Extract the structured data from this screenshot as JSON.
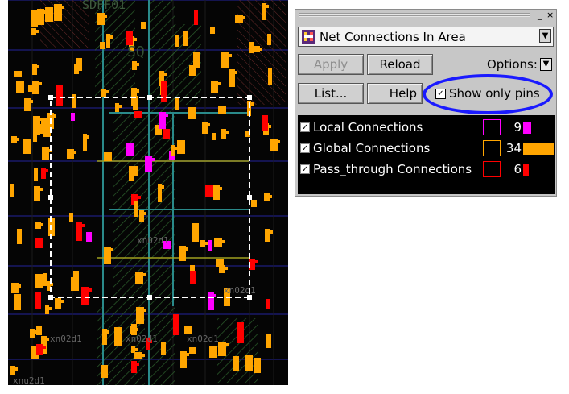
{
  "window": {
    "title": "Net Connections In Area",
    "minimize_glyph": "_",
    "close_glyph": "×"
  },
  "toolbar": {
    "apply_label": "Apply",
    "reload_label": "Reload",
    "options_label": "Options:",
    "list_label": "List...",
    "help_label": "Help",
    "show_only_pins_label": "Show only pins",
    "show_only_pins_checked": true
  },
  "connections": [
    {
      "label": "Local Connections",
      "count": "9",
      "color": "#ff00ff",
      "fill_fraction": 0.26,
      "checked": true
    },
    {
      "label": "Global Connections",
      "count": "34",
      "color": "#ffa500",
      "fill_fraction": 1.0,
      "checked": true
    },
    {
      "label": "Pass_through Connections",
      "count": "6",
      "color": "#ff0000",
      "fill_fraction": 0.18,
      "checked": true
    }
  ],
  "layout_labels": {
    "top_label": "SDFF01",
    "cell_a": "SQ",
    "cell_b": "xn02d1",
    "cell_c": "xn02d1",
    "cell_d": "xn02d1",
    "cell_e": "xn02d1",
    "cell_f": "xn02d1",
    "cell_g": "xnu2d1"
  },
  "colors": {
    "accent_highlight": "#1a1aff",
    "local": "#ff00ff",
    "global": "#ffa500",
    "pass_through": "#ff0000"
  }
}
